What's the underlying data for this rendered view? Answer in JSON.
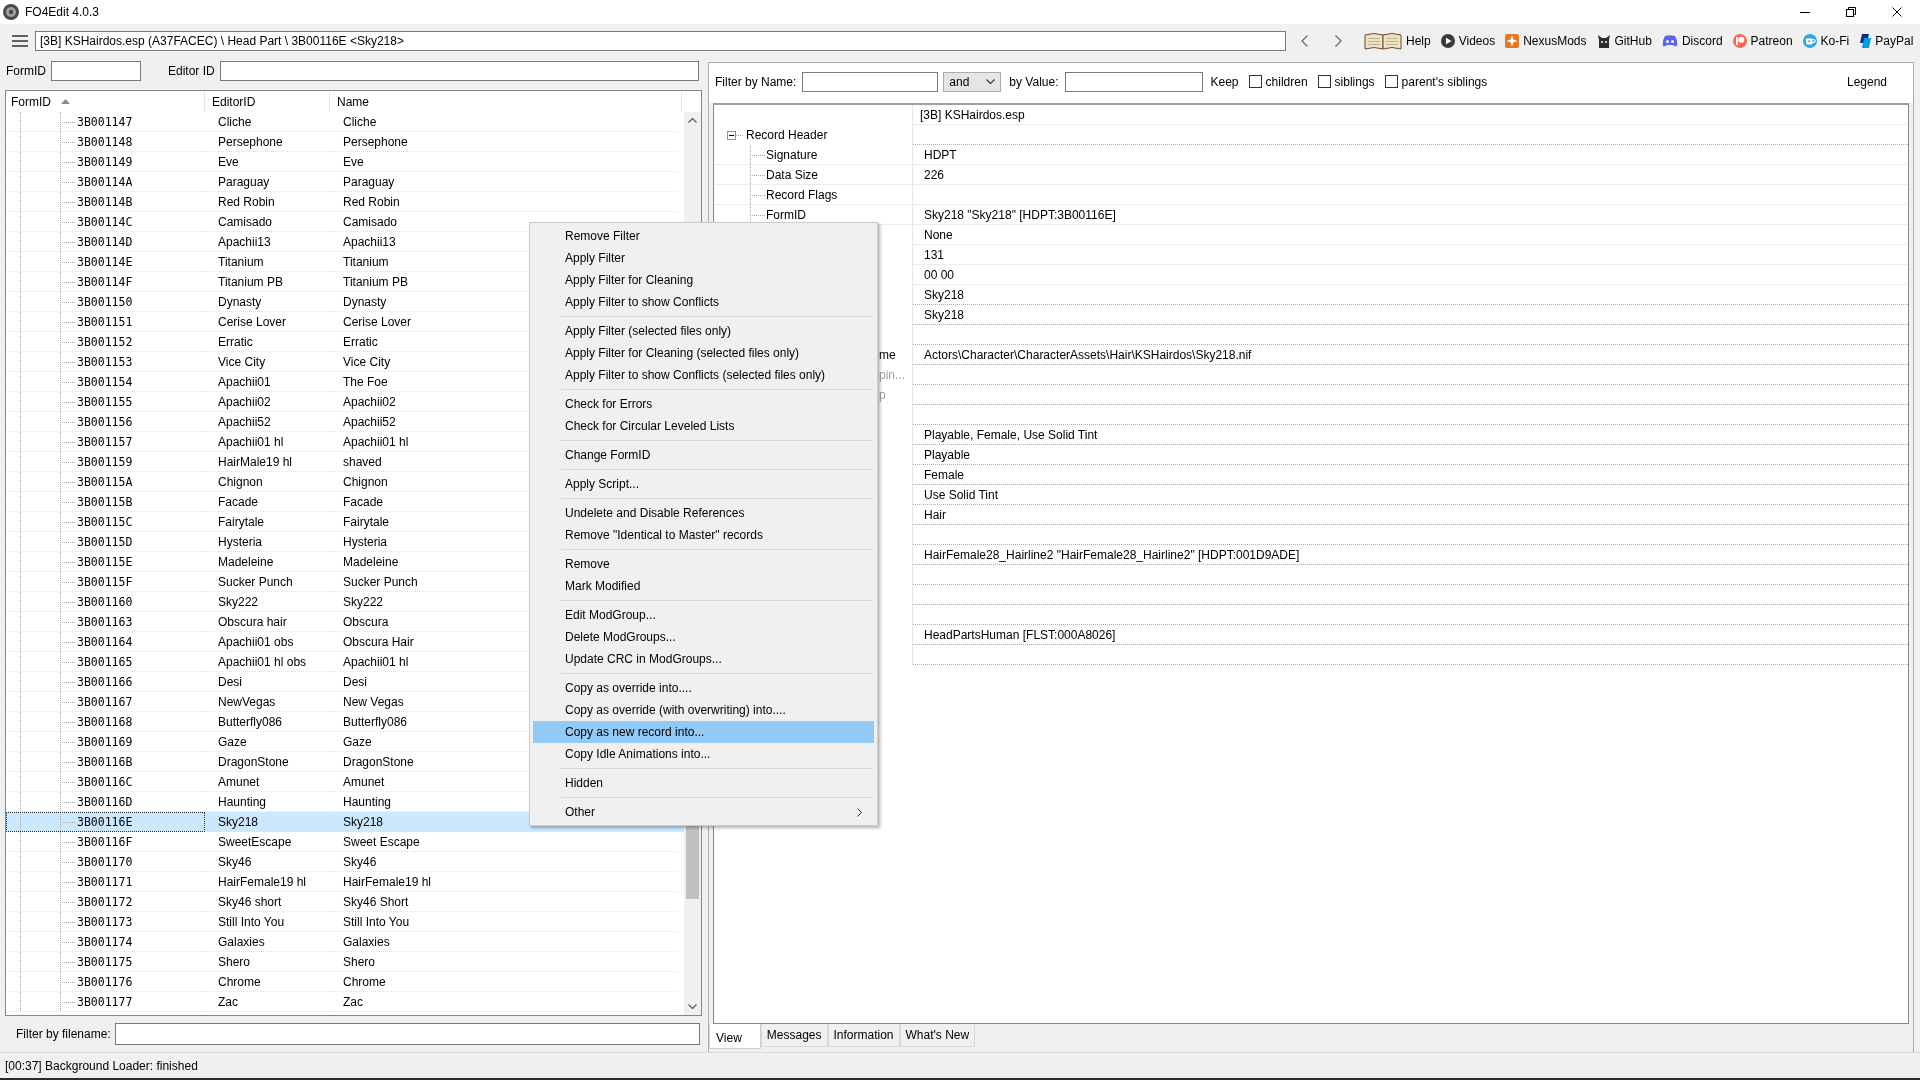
{
  "window": {
    "title": "FO4Edit 4.0.3"
  },
  "toolbar": {
    "path": "[3B] KSHairdos.esp (A37FACEC) \\ Head Part \\ 3B00116E <Sky218>",
    "links": [
      "Help",
      "Videos",
      "NexusMods",
      "GitHub",
      "Discord",
      "Patreon",
      "Ko-Fi",
      "PayPal"
    ]
  },
  "search": {
    "formid_label": "FormID",
    "editor_id_label": "Editor ID"
  },
  "record_list": {
    "columns": [
      {
        "label": "FormID",
        "sorted": true
      },
      {
        "label": "EditorID",
        "sorted": false
      },
      {
        "label": "Name",
        "sorted": false
      }
    ],
    "rows": [
      {
        "cells": [
          "3B001147",
          "Cliche",
          "Cliche"
        ],
        "selected": false
      },
      {
        "cells": [
          "3B001148",
          "Persephone",
          "Persephone"
        ],
        "selected": false
      },
      {
        "cells": [
          "3B001149",
          "Eve",
          "Eve"
        ],
        "selected": false
      },
      {
        "cells": [
          "3B00114A",
          "Paraguay",
          "Paraguay"
        ],
        "selected": false
      },
      {
        "cells": [
          "3B00114B",
          "Red Robin",
          "Red Robin"
        ],
        "selected": false
      },
      {
        "cells": [
          "3B00114C",
          "Camisado",
          "Camisado"
        ],
        "selected": false
      },
      {
        "cells": [
          "3B00114D",
          "Apachii13",
          "Apachii13"
        ],
        "selected": false
      },
      {
        "cells": [
          "3B00114E",
          "Titanium",
          "Titanium"
        ],
        "selected": false
      },
      {
        "cells": [
          "3B00114F",
          "Titanium PB",
          "Titanium PB"
        ],
        "selected": false
      },
      {
        "cells": [
          "3B001150",
          "Dynasty",
          "Dynasty"
        ],
        "selected": false
      },
      {
        "cells": [
          "3B001151",
          "Cerise Lover",
          "Cerise Lover"
        ],
        "selected": false
      },
      {
        "cells": [
          "3B001152",
          "Erratic",
          "Erratic"
        ],
        "selected": false
      },
      {
        "cells": [
          "3B001153",
          "Vice City",
          "Vice City"
        ],
        "selected": false
      },
      {
        "cells": [
          "3B001154",
          "Apachii01",
          "The Foe"
        ],
        "selected": false
      },
      {
        "cells": [
          "3B001155",
          "Apachii02",
          "Apachii02"
        ],
        "selected": false
      },
      {
        "cells": [
          "3B001156",
          "Apachii52",
          "Apachii52"
        ],
        "selected": false
      },
      {
        "cells": [
          "3B001157",
          "Apachii01 hl",
          "Apachii01 hl"
        ],
        "selected": false
      },
      {
        "cells": [
          "3B001159",
          "HairMale19 hl",
          "shaved"
        ],
        "selected": false
      },
      {
        "cells": [
          "3B00115A",
          "Chignon",
          "Chignon"
        ],
        "selected": false
      },
      {
        "cells": [
          "3B00115B",
          "Facade",
          "Facade"
        ],
        "selected": false
      },
      {
        "cells": [
          "3B00115C",
          "Fairytale",
          "Fairytale"
        ],
        "selected": false
      },
      {
        "cells": [
          "3B00115D",
          "Hysteria",
          "Hysteria"
        ],
        "selected": false
      },
      {
        "cells": [
          "3B00115E",
          "Madeleine",
          "Madeleine"
        ],
        "selected": false
      },
      {
        "cells": [
          "3B00115F",
          "Sucker Punch",
          "Sucker Punch"
        ],
        "selected": false
      },
      {
        "cells": [
          "3B001160",
          "Sky222",
          "Sky222"
        ],
        "selected": false
      },
      {
        "cells": [
          "3B001163",
          "Obscura hair",
          "Obscura"
        ],
        "selected": false
      },
      {
        "cells": [
          "3B001164",
          "Apachii01 obs",
          "Obscura Hair"
        ],
        "selected": false
      },
      {
        "cells": [
          "3B001165",
          "Apachii01 hl obs",
          "Apachii01 hl"
        ],
        "selected": false
      },
      {
        "cells": [
          "3B001166",
          "Desi",
          "Desi"
        ],
        "selected": false
      },
      {
        "cells": [
          "3B001167",
          "NewVegas",
          "New Vegas"
        ],
        "selected": false
      },
      {
        "cells": [
          "3B001168",
          "Butterfly086",
          "Butterfly086"
        ],
        "selected": false
      },
      {
        "cells": [
          "3B001169",
          "Gaze",
          "Gaze"
        ],
        "selected": false
      },
      {
        "cells": [
          "3B00116B",
          "DragonStone",
          "DragonStone"
        ],
        "selected": false
      },
      {
        "cells": [
          "3B00116C",
          "Amunet",
          "Amunet"
        ],
        "selected": false
      },
      {
        "cells": [
          "3B00116D",
          "Haunting",
          "Haunting"
        ],
        "selected": false
      },
      {
        "cells": [
          "3B00116E",
          "Sky218",
          "Sky218"
        ],
        "selected": true
      },
      {
        "cells": [
          "3B00116F",
          "SweetEscape",
          "Sweet Escape"
        ],
        "selected": false
      },
      {
        "cells": [
          "3B001170",
          "Sky46",
          "Sky46"
        ],
        "selected": false
      },
      {
        "cells": [
          "3B001171",
          "HairFemale19 hl",
          "HairFemale19 hl"
        ],
        "selected": false
      },
      {
        "cells": [
          "3B001172",
          "Sky46 short",
          "Sky46 Short"
        ],
        "selected": false
      },
      {
        "cells": [
          "3B001173",
          "Still Into You",
          "Still Into You"
        ],
        "selected": false
      },
      {
        "cells": [
          "3B001174",
          "Galaxies",
          "Galaxies"
        ],
        "selected": false
      },
      {
        "cells": [
          "3B001175",
          "Shero",
          "Shero"
        ],
        "selected": false
      },
      {
        "cells": [
          "3B001176",
          "Chrome",
          "Chrome"
        ],
        "selected": false
      },
      {
        "cells": [
          "3B001177",
          "Zac",
          "Zac"
        ],
        "selected": false
      }
    ]
  },
  "filename_filter": {
    "label": "Filter by filename:"
  },
  "status_bar": "[00:37] Background Loader: finished",
  "view_filter": {
    "name_label": "Filter by Name:",
    "operator": "and",
    "value_label": "by Value:",
    "keep_label": "Keep",
    "options": [
      {
        "label": "children",
        "checked": false
      },
      {
        "label": "siblings",
        "checked": false
      },
      {
        "label": "parent's siblings",
        "checked": false
      }
    ],
    "legend": "Legend"
  },
  "record_view": {
    "file_header": "[3B] KSHairdos.esp",
    "rows": [
      {
        "kind": "field",
        "label": "Record Header",
        "expanded": true,
        "disabled": false,
        "children": [
          {
            "kind": "field",
            "label": "Signature",
            "value": "HDPT",
            "disabled": false
          },
          {
            "kind": "field",
            "label": "Data Size",
            "value": "226",
            "disabled": false
          },
          {
            "kind": "field",
            "label": "Record Flags",
            "disabled": false
          },
          {
            "kind": "field",
            "label": "FormID",
            "value": "Sky218 \"Sky218\" [HDPT:3B00116E]",
            "disabled": false
          },
          {
            "kind": "field",
            "value": "None",
            "disabled": false
          },
          {
            "kind": "field",
            "value": "131",
            "disabled": false
          },
          {
            "kind": "field",
            "value": "00 00",
            "disabled": false
          }
        ]
      },
      {
        "kind": "field",
        "value": "Sky218",
        "disabled": false
      },
      {
        "kind": "field",
        "value": "Sky218",
        "disabled": false
      },
      {
        "kind": "field"
      },
      {
        "kind": "partial",
        "label": "me",
        "value": "Actors\\Character\\CharacterAssets\\Hair\\KSHairdos\\Sky218.nif",
        "disabled": false
      },
      {
        "kind": "partial",
        "label": "pin...",
        "disabled": true
      },
      {
        "kind": "partial",
        "label": "p",
        "disabled": true
      },
      {
        "kind": "field"
      },
      {
        "kind": "field",
        "value": "Playable, Female, Use Solid Tint",
        "disabled": false
      },
      {
        "kind": "field",
        "value": "Playable",
        "disabled": false
      },
      {
        "kind": "field",
        "value": "Female",
        "disabled": false
      },
      {
        "kind": "field",
        "value": "Use Solid Tint",
        "disabled": false
      },
      {
        "kind": "field",
        "value": "Hair",
        "disabled": false
      },
      {
        "kind": "field"
      },
      {
        "kind": "field",
        "value": "HairFemale28_Hairline2 \"HairFemale28_Hairline2\" [HDPT:001D9ADE]",
        "disabled": false
      },
      {
        "kind": "field"
      },
      {
        "kind": "field"
      },
      {
        "kind": "field"
      },
      {
        "kind": "field",
        "value": "HeadPartsHuman [FLST:000A8026]",
        "disabled": false
      },
      {
        "kind": "field"
      }
    ]
  },
  "view_tabs": [
    {
      "label": "View",
      "selected": true
    },
    {
      "label": "Messages",
      "selected": false
    },
    {
      "label": "Information",
      "selected": false
    },
    {
      "label": "What's New",
      "selected": false
    }
  ],
  "context_menu": {
    "groups": [
      [
        {
          "label": "Remove Filter",
          "selected": false,
          "submenu": false
        },
        {
          "label": "Apply Filter",
          "selected": false,
          "submenu": false
        },
        {
          "label": "Apply Filter for Cleaning",
          "selected": false,
          "submenu": false
        },
        {
          "label": "Apply Filter to show Conflicts",
          "selected": false,
          "submenu": false
        }
      ],
      [
        {
          "label": "Apply Filter (selected files only)",
          "selected": false,
          "submenu": false
        },
        {
          "label": "Apply Filter for Cleaning (selected files only)",
          "selected": false,
          "submenu": false
        },
        {
          "label": "Apply Filter to show Conflicts (selected files only)",
          "selected": false,
          "submenu": false
        }
      ],
      [
        {
          "label": "Check for Errors",
          "selected": false,
          "submenu": false
        },
        {
          "label": "Check for Circular Leveled Lists",
          "selected": false,
          "submenu": false
        }
      ],
      [
        {
          "label": "Change FormID",
          "selected": false,
          "submenu": false
        }
      ],
      [
        {
          "label": "Apply Script...",
          "selected": false,
          "submenu": false
        }
      ],
      [
        {
          "label": "Undelete and Disable References",
          "selected": false,
          "submenu": false
        },
        {
          "label": "Remove \"Identical to Master\" records",
          "selected": false,
          "submenu": false
        }
      ],
      [
        {
          "label": "Remove",
          "selected": false,
          "submenu": false
        },
        {
          "label": "Mark Modified",
          "selected": false,
          "submenu": false
        }
      ],
      [
        {
          "label": "Edit ModGroup...",
          "selected": false,
          "submenu": false
        },
        {
          "label": "Delete ModGroups...",
          "selected": false,
          "submenu": false
        },
        {
          "label": "Update CRC in ModGroups...",
          "selected": false,
          "submenu": false
        }
      ],
      [
        {
          "label": "Copy as override into....",
          "selected": false,
          "submenu": false
        },
        {
          "label": "Copy as override (with overwriting) into....",
          "selected": false,
          "submenu": false
        },
        {
          "label": "Copy as new record into...",
          "selected": true,
          "submenu": false
        },
        {
          "label": "Copy Idle Animations into...",
          "selected": false,
          "submenu": false
        }
      ],
      [
        {
          "label": "Hidden",
          "selected": false,
          "submenu": false
        }
      ],
      [
        {
          "label": "Other",
          "selected": false,
          "submenu": true
        }
      ]
    ]
  }
}
